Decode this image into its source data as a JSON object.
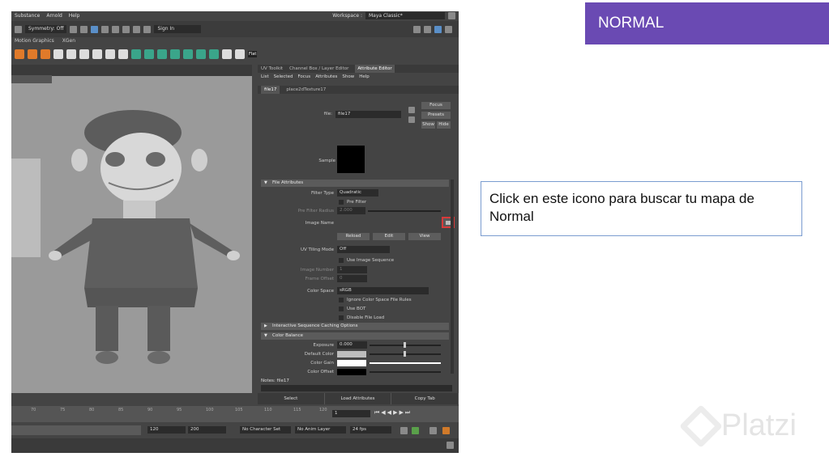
{
  "tag_label": "NORMAL",
  "note_text": "Click en este icono para buscar tu mapa de Normal",
  "watermark": "Platzi",
  "maya": {
    "menu": [
      "Substance",
      "Arnold",
      "Help"
    ],
    "workspace_label": "Workspace :",
    "workspace_value": "Maya Classic*",
    "symmetry": "Symmetry: Off",
    "sign_in": "Sign In",
    "shelf_tabs": [
      "Motion Graphics",
      "XGen"
    ],
    "shelf_flat": "Flat",
    "panel_tabs": [
      "UV Toolkit",
      "Channel Box / Layer Editor",
      "Attribute Editor"
    ],
    "panel_menu": [
      "List",
      "Selected",
      "Focus",
      "Attributes",
      "Show",
      "Help"
    ],
    "node_tabs": [
      "file17",
      "place2dTexture17"
    ],
    "file_label": "file:",
    "file_value": "file17",
    "focus_btn": "Focus",
    "presets_btn": "Presets",
    "show_btn": "Show",
    "hide_btn": "Hide",
    "sample_label": "Sample",
    "sect_file_attrs": "File Attributes",
    "filter_type_label": "Filter Type",
    "filter_type_value": "Quadratic",
    "pre_filter": "Pre Filter",
    "pre_filter_radius_label": "Pre Filter Radius",
    "pre_filter_radius_value": "2.000",
    "image_name_label": "Image Name",
    "reload_btn": "Reload",
    "edit_btn": "Edit",
    "view_btn": "View",
    "uv_tiling_label": "UV Tiling Mode",
    "uv_tiling_value": "Off",
    "use_image_seq": "Use Image Sequence",
    "image_number_label": "Image Number",
    "image_number_value": "1",
    "frame_offset_label": "Frame Offset",
    "frame_offset_value": "0",
    "color_space_label": "Color Space",
    "color_space_value": "sRGB",
    "ignore_cs": "Ignore Color Space File Rules",
    "use_bot": "Use BOT",
    "disable_file_load": "Disable File Load",
    "sect_interactive": "Interactive Sequence Caching Options",
    "sect_color_balance": "Color Balance",
    "exposure_label": "Exposure",
    "exposure_value": "0.000",
    "default_color_label": "Default Color",
    "color_gain_label": "Color Gain",
    "color_offset_label": "Color Offset",
    "notes_label": "Notes: file17",
    "bottom_buttons": [
      "Select",
      "Load Attributes",
      "Copy Tab"
    ],
    "timeline_ticks": [
      "70",
      "75",
      "80",
      "85",
      "90",
      "95",
      "100",
      "105",
      "110",
      "115",
      "120"
    ],
    "current_frame": "1",
    "range_start": "120",
    "range_end": "200",
    "char_set": "No Character Set",
    "anim_layer": "No Anim Layer",
    "fps": "24 fps"
  }
}
